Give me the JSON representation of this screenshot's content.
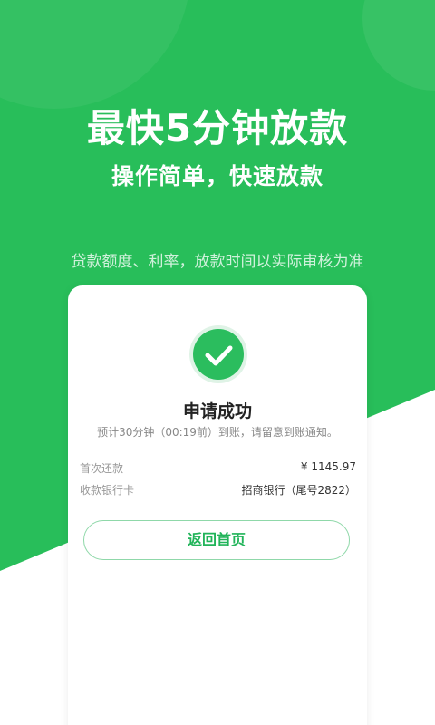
{
  "hero": {
    "title": "最快5分钟放款",
    "subtitle": "操作简单，快速放款",
    "disclaimer": "贷款额度、利率，放款时间以实际审核为准"
  },
  "result": {
    "icon": "check-icon",
    "title": "申请成功",
    "description": "预计30分钟（00:19前）到账，请留意到账通知。"
  },
  "details": [
    {
      "label": "首次还款",
      "value": "¥ 1145.97"
    },
    {
      "label": "收款银行卡",
      "value": "招商银行（尾号2822）"
    }
  ],
  "actions": {
    "home_label": "返回首页"
  },
  "colors": {
    "brand_green": "#28be5a",
    "button_text": "#22b45a"
  }
}
